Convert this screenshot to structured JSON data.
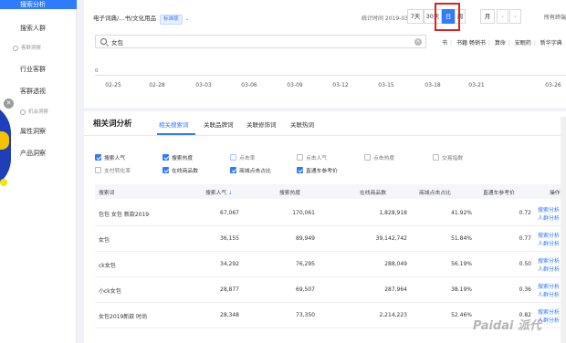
{
  "sidebar": {
    "active_item": "搜索分析",
    "items": [
      "搜索人群",
      "行业客群",
      "客群透视",
      "属性洞察",
      "产品洞察"
    ],
    "groups": [
      "客群洞察",
      "机会洞察"
    ]
  },
  "header": {
    "breadcrumb": "电子词典/...书/文化用品",
    "badge": "标准版",
    "stat_time": "统计时间 2019-03-26",
    "period_buttons": [
      "7天",
      "30天",
      "日",
      "周",
      "月"
    ],
    "active_period": "日",
    "prev_icon": "chevron-left-icon",
    "next_icon": "chevron-right-icon",
    "all_terminals": "所有终端"
  },
  "search": {
    "value": "女包"
  },
  "categories": [
    "书",
    "书籍 畅销书",
    "算命",
    "安眠药",
    "新华字典"
  ],
  "trend": {
    "y_zero": "0",
    "x_ticks": [
      "02-25",
      "02-28",
      "03-03",
      "03-06",
      "03-09",
      "03-12",
      "03-15",
      "03-18",
      "03-21",
      "03-26"
    ]
  },
  "related": {
    "title": "相关词分析",
    "tabs": [
      "相关搜索词",
      "关联品牌词",
      "关联修饰词",
      "关联热词"
    ],
    "active_tab": "相关搜索词",
    "metrics_row1": [
      {
        "label": "搜索人气",
        "checked": true
      },
      {
        "label": "搜索热度",
        "checked": true
      },
      {
        "label": "点击率",
        "checked": false
      },
      {
        "label": "点击人气",
        "checked": false
      },
      {
        "label": "点击热度",
        "checked": false
      },
      {
        "label": "交易指数",
        "checked": false
      }
    ],
    "metrics_row2": [
      {
        "label": "支付转化率",
        "checked": false
      },
      {
        "label": "在线商品数",
        "checked": true
      },
      {
        "label": "商城点击占比",
        "checked": true
      },
      {
        "label": "直通车参考价",
        "checked": true
      }
    ],
    "columns": [
      "搜索词",
      "搜索人气",
      "搜索热度",
      "在线商品数",
      "商城点击占比",
      "直通车参考价",
      "操作"
    ],
    "rows": [
      {
        "term": "包包 女包 新款2019",
        "pop": "67,067",
        "heat": "170,061",
        "items": "1,828,918",
        "mall": "41.92%",
        "price": "0.72",
        "ops": [
          "搜索分析",
          "人群分析"
        ]
      },
      {
        "term": "女包",
        "pop": "36,155",
        "heat": "89,949",
        "items": "39,142,742",
        "mall": "51.84%",
        "price": "0.77",
        "ops": [
          "搜索分析",
          "人群分析"
        ]
      },
      {
        "term": "ck女包",
        "pop": "34,292",
        "heat": "76,295",
        "items": "288,049",
        "mall": "56.19%",
        "price": "0.50",
        "ops": [
          "搜索分析",
          "人群分析"
        ]
      },
      {
        "term": "小ck女包",
        "pop": "28,877",
        "heat": "69,507",
        "items": "287,964",
        "mall": "38.19%",
        "price": "0.36",
        "ops": [
          "搜索分析",
          "人群分析"
        ]
      },
      {
        "term": "女包2019新款 时尚",
        "pop": "28,348",
        "heat": "73,350",
        "items": "2,214,223",
        "mall": "52.46%",
        "price": "0.82",
        "ops": [
          "搜索分析",
          "人群分析"
        ]
      }
    ]
  },
  "watermark": "Paidai 派代"
}
